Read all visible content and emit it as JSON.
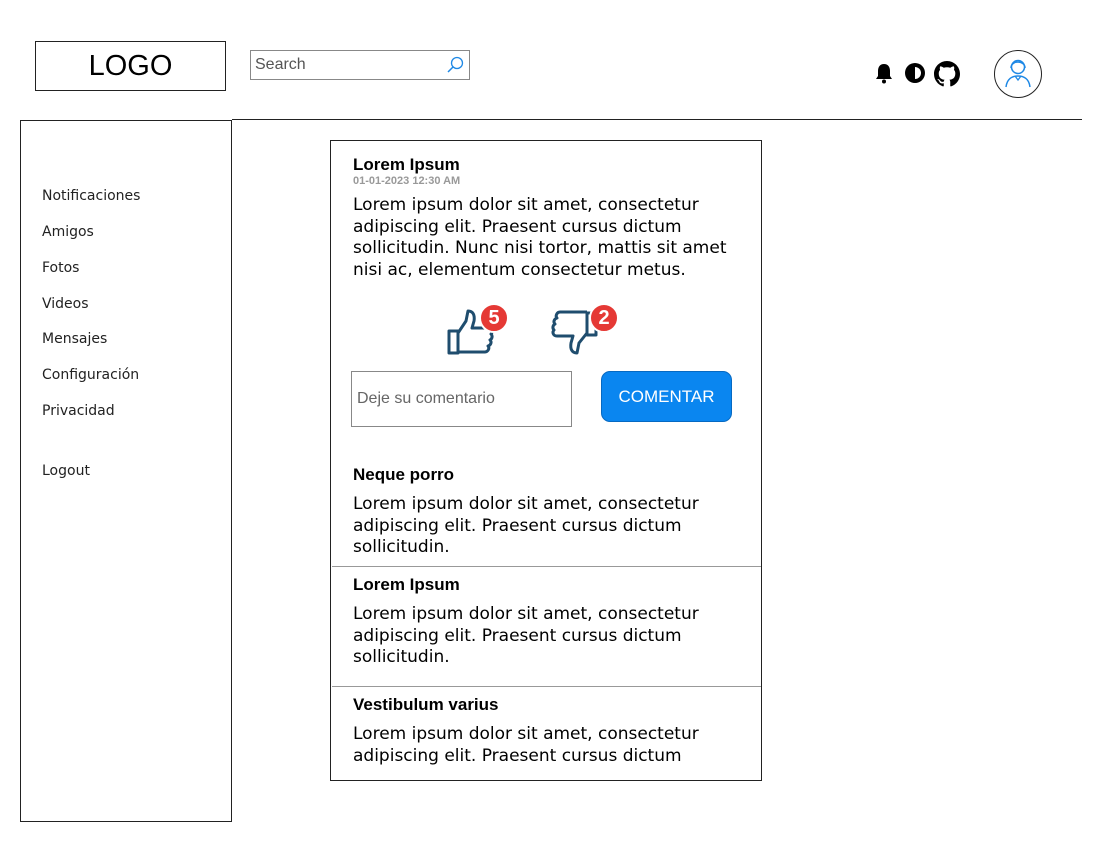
{
  "header": {
    "logo_text": "LOGO",
    "search_placeholder": "Search",
    "icons": [
      "search-icon",
      "bell-icon",
      "contrast-icon",
      "github-icon",
      "user-avatar-icon"
    ]
  },
  "sidebar": {
    "items": [
      {
        "label": "Notificaciones"
      },
      {
        "label": "Amigos"
      },
      {
        "label": "Fotos"
      },
      {
        "label": "Videos"
      },
      {
        "label": "Mensajes"
      },
      {
        "label": "Configuración"
      },
      {
        "label": "Privacidad"
      }
    ],
    "logout_label": "Logout"
  },
  "feed": {
    "posts": [
      {
        "title": "Lorem Ipsum",
        "date": "01-01-2023 12:30 AM",
        "body": "Lorem ipsum dolor sit amet, consectetur adipiscing elit. Praesent cursus dictum sollicitudin. Nunc nisi tortor, mattis sit amet nisi ac, elementum consectetur metus.",
        "likes": "5",
        "dislikes": "2"
      },
      {
        "title": "Neque porro",
        "body": "Lorem ipsum dolor sit amet, consectetur adipiscing elit. Praesent cursus dictum sollicitudin."
      },
      {
        "title": "Lorem Ipsum",
        "body": "Lorem ipsum dolor sit amet, consectetur adipiscing elit. Praesent cursus dictum sollicitudin."
      },
      {
        "title": "Vestibulum varius",
        "body": "Lorem ipsum dolor sit amet, consectetur adipiscing elit. Praesent cursus dictum"
      }
    ],
    "comment_placeholder": "Deje su comentario",
    "comment_button": "COMENTAR"
  },
  "colors": {
    "primary_button": "#0a86f0",
    "badge": "#e53935",
    "thumb_icon": "#1f4d6e",
    "avatar_icon": "#1e88e5"
  }
}
